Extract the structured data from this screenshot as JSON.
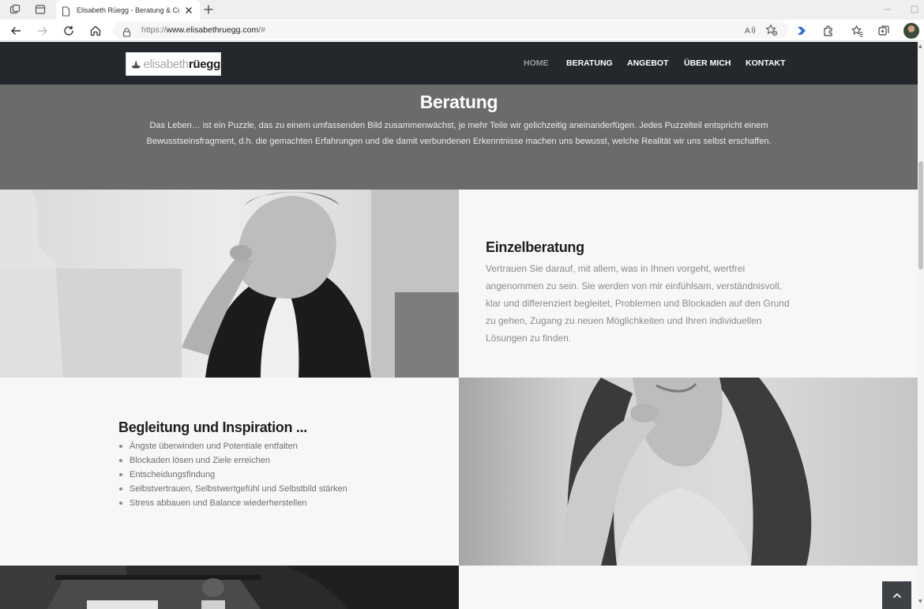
{
  "browser": {
    "tab_title": "Elisabeth Rüegg - Beratung & Coaching",
    "url_scheme": "https://",
    "url_host": "www.elisabethruegg.com",
    "url_path": "/#"
  },
  "site": {
    "logo_light": "elisabeth",
    "logo_bold": "rüegg",
    "nav": [
      {
        "label": "HOME",
        "active": true
      },
      {
        "label": "BERATUNG",
        "active": false
      },
      {
        "label": "ANGEBOT",
        "active": false
      },
      {
        "label": "ÜBER MICH",
        "active": false
      },
      {
        "label": "KONTAKT",
        "active": false
      }
    ]
  },
  "hero": {
    "title": "Beratung",
    "text": "Das Leben… ist ein Puzzle, das zu einem umfassenden Bild zusammenwächst, je mehr Teile wir gelichzeitig aneinanderfügen. Jedes Puzzelteil entspricht einem Bewusstseinsfragment, d.h. die gemachten Erfahrungen und die damit verbundenen Erkenntnisse machen uns bewusst, welche Realität wir uns selbst erschaffen."
  },
  "einzelberatung": {
    "title": "Einzelberatung",
    "text": "Vertrauen Sie darauf, mit allem, was in Ihnen vorgeht, wertfrei angenommen zu sein. Sie werden von mir einfühlsam, verständnisvoll, klar und differenziert begleitet, Problemen und Blockaden auf den Grund zu gehen, Zugang zu neuen Möglichkeiten und Ihren individuellen Lösungen zu finden."
  },
  "begleitung": {
    "title": "Begleitung und Inspiration ...",
    "items": [
      "Ängste überwinden und Potentiale entfalten",
      "Blockaden lösen und Ziele erreichen",
      "Entscheidungsfindung",
      "Selbstvertrauen, Selbstwertgefühl und Selbstbild stärken",
      "Stress abbauen und Balance wiederherstellen"
    ]
  },
  "colors": {
    "header_bg": "#24272b",
    "hero_bg": "#6b6b6b",
    "panel_bg": "#f7f7f7",
    "nav_active": "#9a9a9a"
  }
}
